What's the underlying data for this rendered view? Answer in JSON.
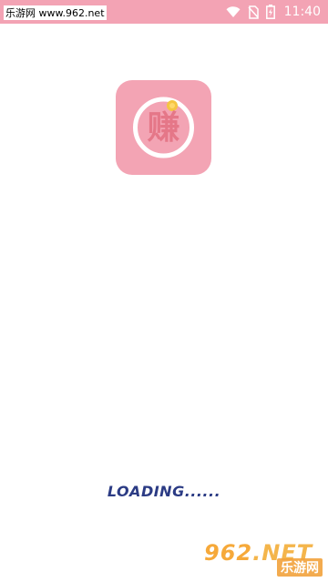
{
  "status_bar": {
    "left_text": "乐游网 www.962.net",
    "time": "11:40",
    "background_color": "#f3a3b4",
    "icons": [
      "wifi-icon",
      "no-sim-icon",
      "battery-charging-icon"
    ]
  },
  "app_icon": {
    "glyph": "赚",
    "background_color": "#f3a4b4",
    "ring_color": "#ffffff",
    "coin_color": "#f5c542",
    "icon": "app-logo-icon"
  },
  "loading": {
    "text": "LOADING......",
    "color": "#2b3b84"
  },
  "watermark": {
    "top": "962",
    "top_suffix": ".NET",
    "bottom": "乐游网"
  }
}
